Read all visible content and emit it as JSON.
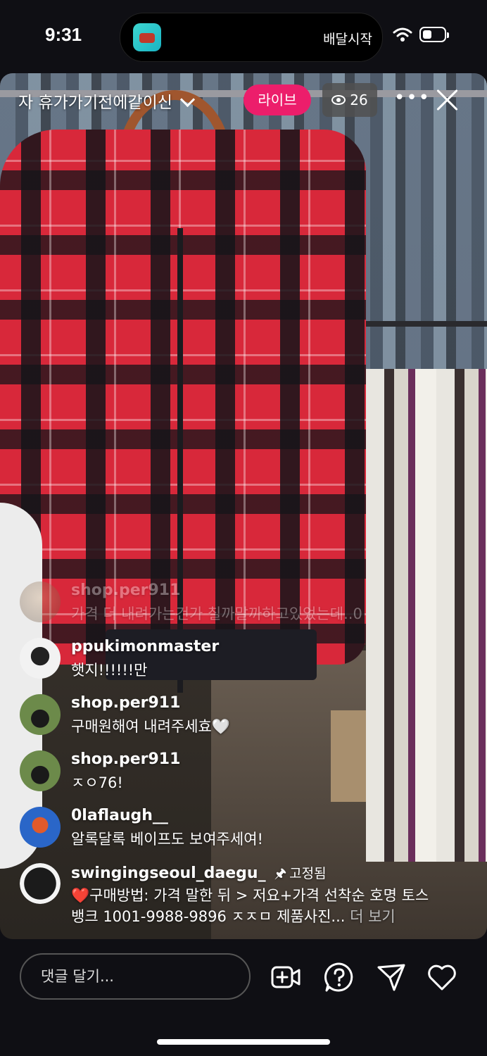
{
  "status_bar": {
    "time": "9:31",
    "island_text": "배달시작"
  },
  "header": {
    "title": "자  휴가가기전에같이신",
    "live_label": "라이브",
    "viewer_count": "26",
    "more_label": "•••"
  },
  "comments": [
    {
      "username": "shop.per911",
      "text": "가격 더 내려가는건가 칠까말까하고있었는데..0",
      "faded": true
    },
    {
      "username": "ppukimonmaster",
      "text": "햇지!!!!!!만"
    },
    {
      "username": "shop.per911",
      "text": "구매원해여 내려주세효🤍"
    },
    {
      "username": "shop.per911",
      "text": "ㅈㅇ76!"
    },
    {
      "username": "0laflaugh__",
      "text": "알록달록 베이프도 보여주세여!"
    },
    {
      "username": "swingingseoul_daegu_",
      "pinned_label": "고정됨",
      "text_line1": "❤️구매방법: 가격 말한 뒤 > 저요+가격 선착순 호명  토스",
      "text_line2": "뱅크 1001-9988-9896 ㅈㅈㅁ 제품사진...",
      "more_label": " 더 보기"
    }
  ],
  "footer": {
    "comment_placeholder": "댓글 달기...",
    "icons": [
      "add-video-icon",
      "question-icon",
      "send-icon",
      "heart-icon"
    ]
  },
  "colors": {
    "live_badge": "#ec1e6b",
    "background": "#0f0f14"
  }
}
